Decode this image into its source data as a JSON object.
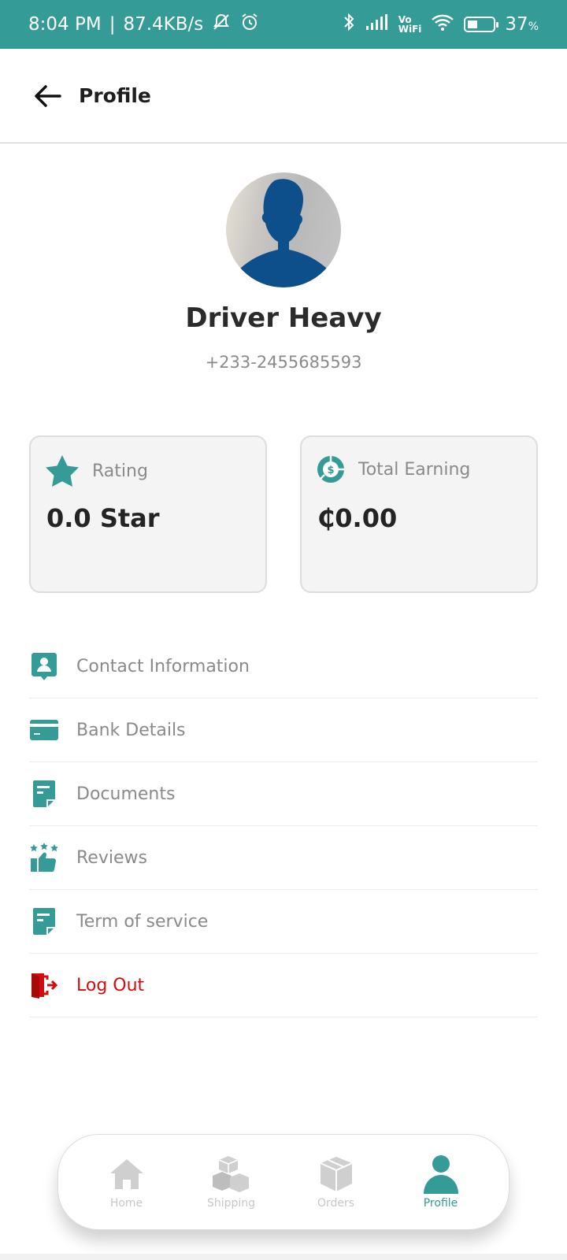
{
  "status_bar": {
    "time": "8:04 PM",
    "network_speed": "87.4KB/s",
    "vowifi_top": "Vo",
    "vowifi_bottom": "WiFi",
    "battery": "37",
    "battery_unit": "%"
  },
  "app_bar": {
    "title": "Profile"
  },
  "profile": {
    "name": "Driver Heavy",
    "phone": "+233-2455685593"
  },
  "stats": {
    "rating": {
      "label": "Rating",
      "value": "0.0 Star"
    },
    "earning": {
      "label": "Total Earning",
      "value": "₵0.00"
    }
  },
  "menu": {
    "items": [
      {
        "label": "Contact Information",
        "icon": "contact-icon"
      },
      {
        "label": "Bank Details",
        "icon": "card-icon"
      },
      {
        "label": "Documents",
        "icon": "document-icon"
      },
      {
        "label": "Reviews",
        "icon": "reviews-icon"
      },
      {
        "label": "Term of service",
        "icon": "document-icon"
      },
      {
        "label": "Log Out",
        "icon": "logout-icon"
      }
    ]
  },
  "bottom_nav": {
    "items": [
      {
        "label": "Home",
        "icon": "home-icon"
      },
      {
        "label": "Shipping",
        "icon": "shipping-icon"
      },
      {
        "label": "Orders",
        "icon": "box-icon"
      },
      {
        "label": "Profile",
        "icon": "person-icon",
        "active": true
      }
    ]
  },
  "colors": {
    "accent": "#349b96",
    "logout": "#d10d0d",
    "card_bg": "#f4f4f4",
    "avatar_silhouette": "#0d4f8b"
  }
}
